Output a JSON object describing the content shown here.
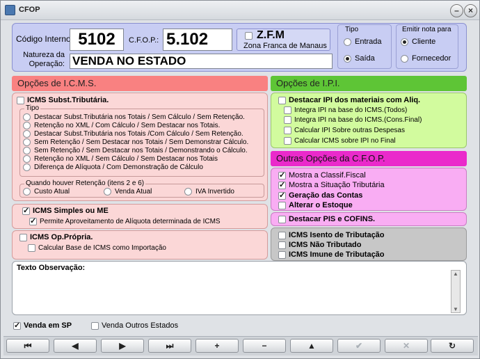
{
  "window": {
    "title": "CFOP"
  },
  "top": {
    "codigo_label": "Código Interno:",
    "codigo_value": "5102",
    "cfop_label": "C.F.O.P.:",
    "cfop_value": "5.102",
    "zfm_label": "Z.F.M",
    "zfm_sub": "Zona Franca de Manaus",
    "natureza_label1": "Natureza da",
    "natureza_label2": "Operação:",
    "natureza_value": "VENDA NO ESTADO"
  },
  "tipo": {
    "title": "Tipo",
    "options": [
      "Entrada",
      "Saída"
    ],
    "selected": "Saída"
  },
  "emitir": {
    "title": "Emitir nota para",
    "options": [
      "Cliente",
      "Fornecedor"
    ],
    "selected": "Cliente"
  },
  "icms": {
    "header": "Opções de I.C.M.S.",
    "subst_label": "ICMS Subst.Tributária.",
    "tipo_title": "Tipo",
    "tipo_options": [
      "Destacar Subst.Tributária nos Totais / Sem Cálculo / Sem Retenção.",
      "Retenção no XML / Com Cálculo / Sem Destacar nos Totais.",
      "Destacar Subst.Tributária nos Totais /Com Cálculo / Sem Retenção.",
      "Sem Retenção / Sem Destacar nos Totais / Sem Demonstrar Cálculo.",
      "Sem Retenção / Sem Destacar nos Totais / Demonstrando o Cálculo.",
      "Retenção no XML / Sem Cálculo / Sem Destacar nos Totais",
      "Diferença de Alíquota / Com Demonstração de Cálculo"
    ],
    "retencao_title": "Quando houver Retenção (itens 2 e 6)",
    "retencao_options": [
      "Custo Atual",
      "Venda Atual",
      "IVA Invertido"
    ],
    "simples_label": "ICMS Simples ou ME",
    "simples_sub": "Permite Aproveitamento de Alíquota determinada de ICMS",
    "propria_label": "ICMS Op.Própria.",
    "propria_sub": "Calcular Base de ICMS como Importação"
  },
  "ipi": {
    "header": "Opções de I.P.I.",
    "main": "Destacar IPI dos materiais com Aliq.",
    "subs": [
      "Integra IPI na base do ICMS.(Todos)",
      "Integra IPI na base do ICMS.(Cons.Final)",
      "Calcular IPI Sobre outras Despesas",
      "Calcular ICMS sobre IPI no Final"
    ]
  },
  "outras": {
    "header": "Outras Opções da C.F.O.P.",
    "items": [
      "Mostra a Classif.Fiscal",
      "Mostra a Situação Tributária",
      "Geração das Contas",
      "Alterar o Estoque"
    ],
    "pis_label": "Destacar PIS e COFINS."
  },
  "isento": {
    "items": [
      "ICMS Isento de Tributação",
      "ICMS Não Tributado",
      "ICMS Imune de Tributação"
    ]
  },
  "obs": {
    "label": "Texto Observação:",
    "value": ""
  },
  "footer": {
    "venda_sp": "Venda em SP",
    "venda_outros": "Venda Outros Estados"
  },
  "nav": {
    "first": "⏮",
    "prev": "◀",
    "next": "▶",
    "last": "⏭",
    "add": "+",
    "remove": "−",
    "up": "▲",
    "confirm": "✔",
    "cancel": "✕",
    "refresh": "↻"
  }
}
